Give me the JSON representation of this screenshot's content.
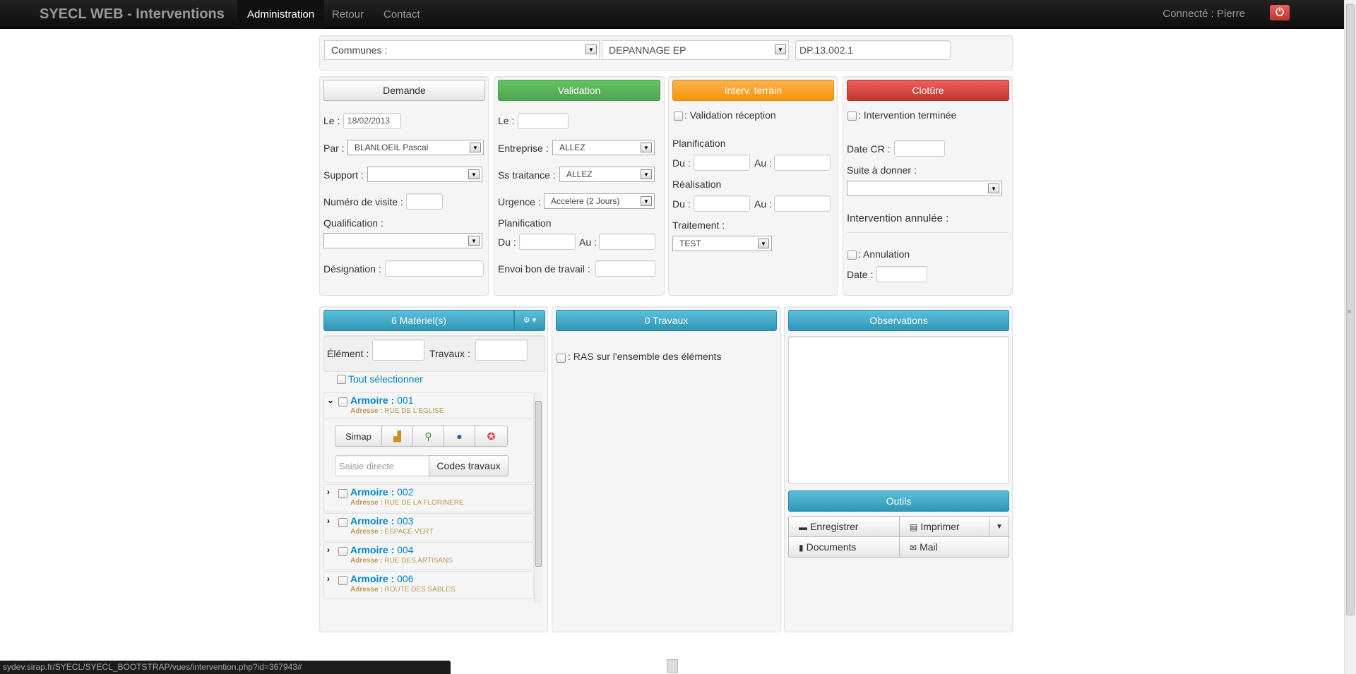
{
  "navbar": {
    "brand": "SYECL WEB - Interventions",
    "items": [
      "Administration",
      "Retour",
      "Contact"
    ],
    "connected": "Connecté : Pierre"
  },
  "filters": {
    "communes": "Communes :",
    "type": "DEPANNAGE EP",
    "code": "DP.13.002.1"
  },
  "demande": {
    "header": "Demande",
    "le_label": "Le :",
    "le_value": "18/02/2013",
    "par_label": "Par :",
    "par_value": "BLANLOEIL Pascal",
    "support_label": "Support :",
    "numero_label": "Numéro de visite :",
    "qualification_label": "Qualification :",
    "designation_label": "Désignation :"
  },
  "validation": {
    "header": "Validation",
    "le_label": "Le :",
    "entreprise_label": "Entreprise :",
    "entreprise_value": "ALLEZ",
    "sstraitance_label": "Ss traitance :",
    "sstraitance_value": "ALLEZ",
    "urgence_label": "Urgence :",
    "urgence_value": "Accelere (2 Jours)",
    "planification_label": "Planification",
    "du_label": "Du :",
    "au_label": "Au :",
    "envoi_label": "Envoi bon de travail :"
  },
  "terrain": {
    "header": "Interv. terrain",
    "validation_reception": ": Validation réception",
    "planification_label": "Planification",
    "realisation_label": "Réalisation",
    "du_label": "Du :",
    "au_label": "Au :",
    "traitement_label": "Traitement :",
    "traitement_value": "TEST"
  },
  "cloture": {
    "header": "Clotûre",
    "terminee": ": Intervention terminée",
    "datecr_label": "Date CR :",
    "suite_label": "Suite à donner :",
    "annulee_label": "Intervention annulée :",
    "annulation": ": Annulation",
    "date_label": "Date :"
  },
  "materiel": {
    "header": "6 Matériel(s)",
    "element_label": "Élément :",
    "travaux_label": "Travaux :",
    "tout_selectionner": "Tout sélectionner",
    "title_prefix": "Armoire :",
    "addr_prefix": "Adresse :",
    "items": [
      {
        "num": "001",
        "addr": "RUE DE L'EGLISE"
      },
      {
        "num": "002",
        "addr": "RUE DE LA FLORINERE"
      },
      {
        "num": "003",
        "addr": "ESPACE VERT"
      },
      {
        "num": "004",
        "addr": "RUE DES ARTISANS"
      },
      {
        "num": "006",
        "addr": "ROUTE DES SABLES"
      }
    ],
    "toolbar": {
      "simap": "Simap"
    },
    "saisie_placeholder": "Saisie directe",
    "codes_travaux": "Codes travaux"
  },
  "travaux": {
    "header": "0 Travaux",
    "ras": ": RAS sur l'ensemble des éléments"
  },
  "observations": {
    "header": "Observations"
  },
  "outils": {
    "header": "Outils",
    "enregistrer": "Enregistrer",
    "imprimer": "Imprimer",
    "documents": "Documents",
    "mail": "Mail"
  },
  "status_url": "sydev.sirap.fr/SYECL/SYECL_BOOTSTRAP/vues/intervention.php?id=367943#",
  "colors": {
    "navbar": "#1b1b1b",
    "green": "#5bb75b",
    "orange": "#faa732",
    "red": "#da4f49",
    "blue": "#49afcd",
    "link": "#0088cc",
    "address": "#c09853"
  },
  "icons": [
    "power-icon",
    "gear-icon",
    "caret-down-icon",
    "chevron-right-icon",
    "chevron-down-icon",
    "save-icon",
    "print-icon",
    "document-icon",
    "mail-icon"
  ]
}
